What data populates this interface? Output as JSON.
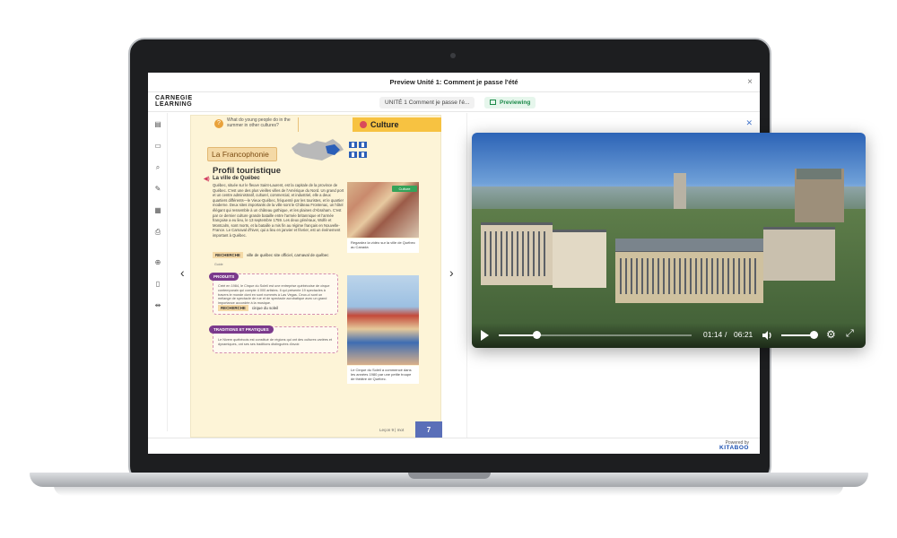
{
  "window": {
    "title": "Preview Unité 1: Comment je passe l'été",
    "close": "×"
  },
  "appbar": {
    "logo_line1": "CARNEGIE",
    "logo_line2": "LEARNING",
    "unit_label": "UNITÉ 1 Comment je passe l'é...",
    "status_label": "Previewing"
  },
  "toolbar": {
    "icons": [
      "toc-icon",
      "notes-icon",
      "search-icon",
      "highlight-icon",
      "resources-icon",
      "print-icon",
      "zoom-in-icon",
      "fit-page-icon",
      "fit-width-icon"
    ]
  },
  "page": {
    "question": "What do young people do in the summer in other cultures?",
    "culture_heading": "Culture",
    "section_title": "La Francophonie",
    "profile_title": "Profil touristique",
    "city_heading": "La ville de Québec",
    "body": "Québec, située sur le fleuve Saint-Laurent, est la capitale de la province de Québec. C'est une des plus vieilles villes de l'Amérique du Nord. Un grand port et un centre administratif, culturel, commercial, et industriel, elle a deux quartiers différents—le Vieux-Québec, fréquenté par les touristes, et le quartier moderne. Deux sites importants de la ville sont le Château Frontenac, un hôtel élégant qui ressemble à un château gothique, et les plaines d'Abraham. C'est par ce dernier culture grande bataille entre l'armée britannique et l'armée française a eu lieu, le 13 septembre 1759. Les deux généraux, Wolfe et Montcalm, sont morts, et la bataille a mis fin au régime français en Nouvelle-France. Le Carnaval d'hiver, qui a lieu en janvier et février, est un événement important à Québec.",
    "research_label": "RECHERCHE",
    "research_text": "ville de québec site officiel, carnaval de québec",
    "source_note": "Guide",
    "photo1_tag": "Culture",
    "photo1_caption": "Regardez la vidéo sur la ville de Québec au Canada",
    "products_label": "PRODUITS",
    "products_text": "Créé en 1984, le Cirque du Soleil est une entreprise québécoise de cirque contemporain qui compte 4 000 artistes. Il qui présente 19 spectacles à travers le monde dont en sont nommés à Las Vegas. Ceux-ci sont un mélange de spectacle de rue et de spectacle acrobatique avec un grand importance accordée à la musique.",
    "products_research_label": "RECHERCHE",
    "products_research_text": "cirque du soleil",
    "traditions_label": "TRADITIONS ET PRATIQUES",
    "traditions_text": "Le Nivem québécois est constitué de régions qui ont des cultures variées et dynamiques, ont ses ses traditions distinguées d'avoir.",
    "photo2_caption": "Le Cirque du Soleil a commencé dans les années 1980 par une petite troupe de théâtre de Québec.",
    "footer_label": "Leçon 9",
    "footer_sub": "mot",
    "page_number": "7"
  },
  "navigation": {
    "prev": "‹",
    "next": "›"
  },
  "video": {
    "current_time": "01:14",
    "duration": "06:21",
    "progress_fraction": 0.195,
    "volume_fraction": 1.0
  },
  "footer": {
    "powered_by": "Powered by",
    "brand": "KITABOO"
  },
  "colors": {
    "page_bg": "#fdf4d7",
    "culture_accent": "#f7c241",
    "previewing_green": "#1c8a4a",
    "section_purple": "#7b3a8c",
    "page_number_bg": "#5a6fb8"
  }
}
